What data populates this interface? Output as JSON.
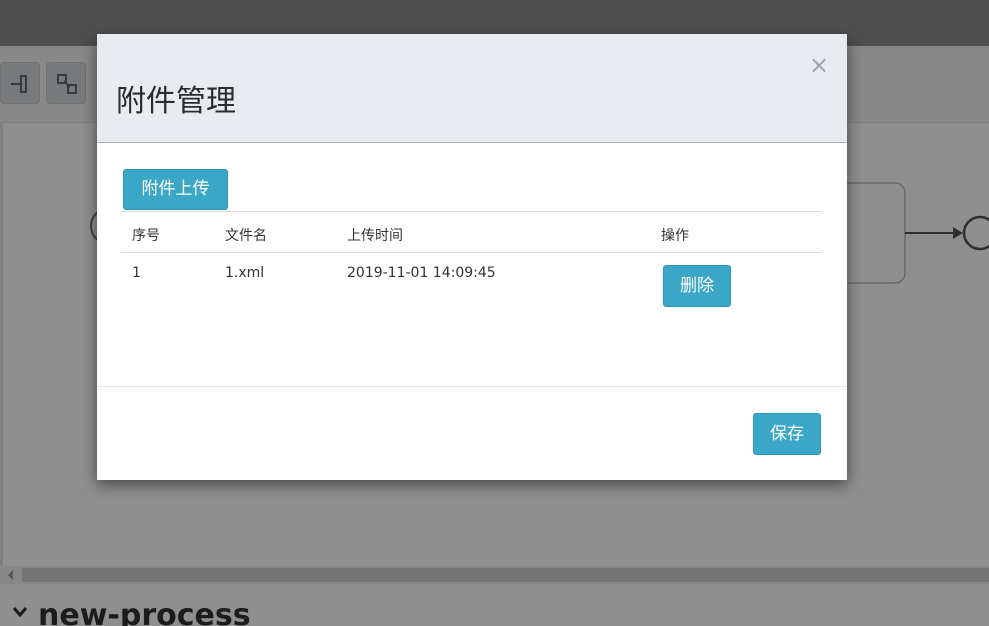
{
  "background": {
    "process_title": "new-process"
  },
  "modal": {
    "title": "附件管理",
    "close_glyph": "×",
    "upload_button_label": "附件上传",
    "save_button_label": "保存",
    "table": {
      "headers": [
        "序号",
        "文件名",
        "上传时间",
        "操作"
      ],
      "rows": [
        {
          "index": "1",
          "filename": "1.xml",
          "upload_time": "2019-11-01 14:09:45",
          "action_label": "删除"
        }
      ]
    }
  },
  "colors": {
    "primary_button": "#3ba7c6",
    "modal_header_bg": "#e8ecf0",
    "overlay": "rgba(0,0,0,0.44)"
  }
}
